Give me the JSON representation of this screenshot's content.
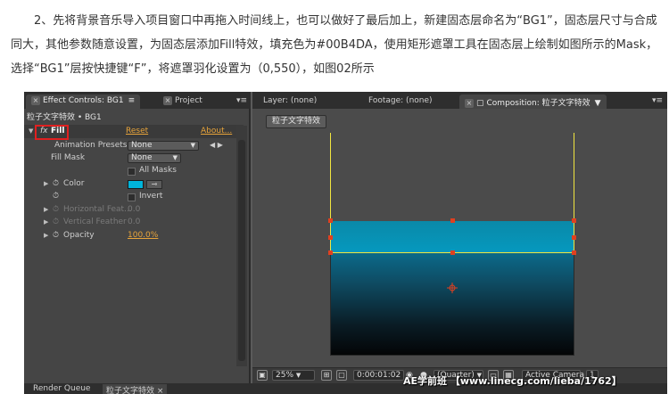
{
  "article": {
    "paragraph": "2、先将背景音乐导入项目窗口中再拖入时间线上，也可以做好了最后加上，新建固态层命名为“BG1”，固态层尺寸与合成同大，其他参数随意设置，为固态层添加Fill特效，填充色为#00B4DA，使用矩形遮罩工具在固态层上绘制如图所示的Mask，选择“BG1”层按快捷键“F”，将遮罩羽化设置为（0,550），如图02所示"
  },
  "effect_panel": {
    "tab_effect_controls": "Effect Controls: BG1",
    "tab_project": "Project",
    "path": "粒子文字特效 • BG1",
    "effect": {
      "fx_label": "fx",
      "name": "Fill",
      "reset": "Reset",
      "about": "About..."
    },
    "animation_presets": {
      "label": "Animation Presets:",
      "value": "None"
    },
    "fill_mask": {
      "label": "Fill Mask",
      "value": "None"
    },
    "all_masks": "All Masks",
    "color": {
      "label": "Color",
      "hex": "#00b4da"
    },
    "invert": "Invert",
    "horizontal_feather": {
      "label": "Horizontal Feat...",
      "value": "0.0"
    },
    "vertical_feather": {
      "label": "Vertical Feather",
      "value": "0.0"
    },
    "opacity": {
      "label": "Opacity",
      "value": "100.0%"
    }
  },
  "viewer": {
    "tab_layer": "Layer: (none)",
    "tab_footage": "Footage: (none)",
    "tab_composition": "Composition: 粒子文字特效",
    "comp_button": "粒子文字特效",
    "zoom": "25%",
    "timecode": "0:00:01:02",
    "resolution": "(Quarter)",
    "view": "Active Camera",
    "views_count": "1"
  },
  "bottom_tabs": {
    "render_queue": "Render Queue",
    "timeline": "粒子文字特效"
  },
  "watermark": "AE学前班 【www.linecg.com/lieba/1762】"
}
